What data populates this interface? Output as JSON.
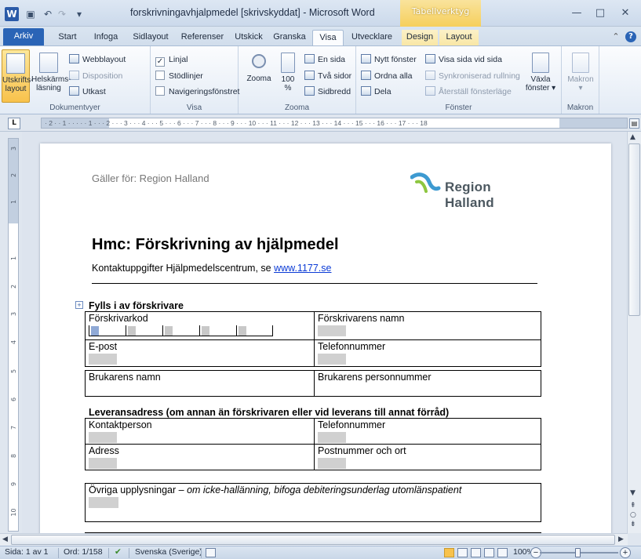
{
  "window": {
    "title": "forskrivningavhjalpmedel [skrivskyddat]  -  Microsoft Word",
    "context_tab_title": "Tabellverktyg",
    "minimize": "—",
    "maximize": "□",
    "close": "✕"
  },
  "qat": {
    "save_icon": "save-icon",
    "undo": "↶",
    "redo": "↷",
    "customize": "▾"
  },
  "tabs": {
    "file": "Arkiv",
    "home": "Start",
    "insert": "Infoga",
    "page_layout": "Sidlayout",
    "references": "Referenser",
    "mailings": "Utskick",
    "review": "Granska",
    "view": "Visa",
    "developer": "Utvecklare",
    "design": "Design",
    "layout": "Layout"
  },
  "ribbon": {
    "groups": {
      "document_views": "Dokumentvyer",
      "show": "Visa",
      "zoom": "Zooma",
      "window": "Fönster",
      "macros": "Makron"
    },
    "document_views": {
      "print_layout_1": "Utskrifts-",
      "print_layout_2": "layout",
      "full_screen_1": "Helskärms-",
      "full_screen_2": "läsning",
      "web_layout": "Webblayout",
      "outline": "Disposition",
      "draft": "Utkast"
    },
    "show": {
      "ruler": "Linjal",
      "gridlines": "Stödlinjer",
      "nav_pane": "Navigeringsfönstret",
      "ruler_checked": "✓"
    },
    "zoom": {
      "zoom": "Zooma",
      "hundred_1": "100",
      "hundred_2": "%",
      "one_page": "En sida",
      "two_pages": "Två sidor",
      "page_width": "Sidbredd"
    },
    "window": {
      "new_window": "Nytt fönster",
      "arrange_all": "Ordna alla",
      "split": "Dela",
      "side_by_side": "Visa sida vid sida",
      "sync_scroll": "Synkroniserad rullning",
      "reset_position": "Återställ fönsterläge",
      "switch_1": "Växla",
      "switch_2": "fönster ▾"
    },
    "macros": {
      "label": "Makron",
      "arrow": "▾"
    }
  },
  "ruler": {
    "tab_selector": "L",
    "horizontal": "·  2 ·  ·  1 ·  ·  ·      ·  ·  1 ·  ·  ·  2 ·  ·  ·  3 ·  ·  ·  4 ·  ·  ·  5 ·  ·  ·  6 ·  ·  ·  7 ·  ·  ·  8 ·  ·  ·  9 ·  ·  ·  10 ·  ·  ·  11 ·  ·  ·  12 ·  ·  ·  13 ·  ·  ·  14 ·  ·  ·  15 ·  ·  ·  16 ·  ·  ·  17 ·  ·  ·  18",
    "vertical_marks": [
      "3",
      "2",
      "1",
      "1",
      "2",
      "3",
      "4",
      "5",
      "6",
      "7",
      "8",
      "9",
      "10"
    ]
  },
  "document": {
    "applies_to": "Gäller för: Region Halland",
    "logo_text": "Region Halland",
    "title": "Hmc: Förskrivning av hjälpmedel",
    "contact_prefix": "Kontaktuppgifter Hjälpmedelscentrum, se ",
    "contact_link": "www.1177.se",
    "prescriber_heading": "Fylls i av förskrivare",
    "prescriber_table": {
      "code_label": "Förskrivarkod",
      "name_label": "Förskrivarens namn",
      "email_label": "E-post",
      "phone_label": "Telefonnummer"
    },
    "user_table": {
      "name_label": "Brukarens namn",
      "pnr_label": "Brukarens personnummer"
    },
    "delivery_heading": "Leveransadress (om annan än förskrivaren eller vid leverans till annat förråd)",
    "delivery_table": {
      "contact_label": "Kontaktperson",
      "phone_label": "Telefonnummer",
      "address_label": "Adress",
      "postal_label": "Postnummer och ort"
    },
    "other_info_label": "Övriga upplysningar",
    "other_info_dash": " – ",
    "other_info_note": "om icke-hallänning, bifoga debiteringsunderlag utomlänspatient"
  },
  "statusbar": {
    "page": "Sida: 1 av 1",
    "words": "Ord: 1/158",
    "language": "Svenska (Sverige)",
    "zoom": "100%",
    "zoom_minus": "−",
    "zoom_plus": "+"
  }
}
